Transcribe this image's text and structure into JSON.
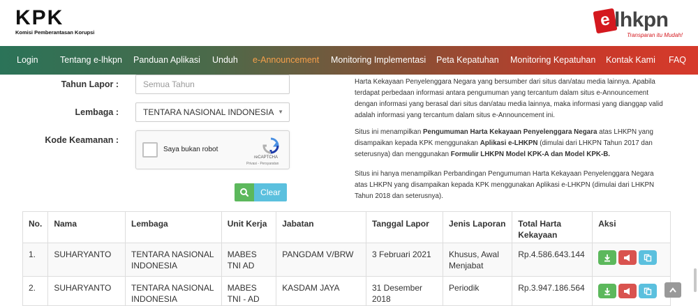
{
  "header": {
    "kpk_logo_text": "KPK",
    "kpk_subtitle": "Komisi Pemberantasan Korupsi",
    "elhkpn_e": "e",
    "elhkpn_word": "lhkpn",
    "elhkpn_tagline": "Transparan itu Mudah!"
  },
  "nav": {
    "items": [
      {
        "label": "Login"
      },
      {
        "label": "Tentang e-lhkpn"
      },
      {
        "label": "Panduan Aplikasi"
      },
      {
        "label": "Unduh"
      },
      {
        "label": "e-Announcement",
        "active": true
      },
      {
        "label": "Monitoring Implementasi"
      },
      {
        "label": "Peta Kepatuhan"
      },
      {
        "label": "Monitoring Kepatuhan"
      },
      {
        "label": "Kontak Kami"
      },
      {
        "label": "FAQ"
      }
    ],
    "active_color": "#f6a04b"
  },
  "form": {
    "tahun_label": "Tahun Lapor :",
    "tahun_placeholder": "Semua Tahun",
    "lembaga_label": "Lembaga :",
    "lembaga_value": "TENTARA NASIONAL INDONESIA",
    "kode_label": "Kode Keamanan :",
    "captcha_label": "Saya bukan robot",
    "captcha_brand": "reCAPTCHA",
    "captcha_links": "Privasi - Persyaratan",
    "clear_label": "Clear"
  },
  "info": {
    "p1": "Harta Kekayaan Penyelenggara Negara yang bersumber dari situs dan/atau media lainnya. Apabila terdapat perbedaan informasi antara pengumuman yang tercantum dalam situs e-Announcement dengan informasi yang berasal dari situs dan/atau media lainnya, maka informasi yang dianggap valid adalah informasi yang tercantum dalam situs e-Announcement ini.",
    "p2_a": "Situs ini menampilkan ",
    "p2_b": "Pengumuman Harta Kekayaan Penyelenggara Negara",
    "p2_c": " atas LHKPN yang disampaikan kepada KPK menggunakan ",
    "p2_d": "Aplikasi e-LHKPN",
    "p2_e": " (dimulai dari LHKPN Tahun 2017 dan seterusnya) dan menggunakan ",
    "p2_f": "Formulir LHKPN Model KPK-A dan Model KPK-B.",
    "p3": "Situs ini hanya menampilkan Perbandingan Pengumuman Harta Kekayaan Penyelenggara Negara atas LHKPN yang disampaikan kepada KPK menggunakan Aplikasi e-LHKPN (dimulai dari LHKPN Tahun 2018 dan seterusnya)."
  },
  "table": {
    "headers": {
      "no": "No.",
      "nama": "Nama",
      "lembaga": "Lembaga",
      "unit": "Unit Kerja",
      "jabatan": "Jabatan",
      "tanggal": "Tanggal Lapor",
      "jenis": "Jenis Laporan",
      "total": "Total Harta Kekayaan",
      "aksi": "Aksi"
    },
    "rows": [
      {
        "no": "1.",
        "nama": "SUHARYANTO",
        "lembaga": "TENTARA NASIONAL INDONESIA",
        "unit": "MABES TNI AD",
        "jabatan": "PANGDAM V/BRW",
        "tanggal": "3 Februari 2021",
        "jenis": "Khusus, Awal Menjabat",
        "total": "Rp.4.586.643.144"
      },
      {
        "no": "2.",
        "nama": "SUHARYANTO",
        "lembaga": "TENTARA NASIONAL INDONESIA",
        "unit": "MABES TNI - AD",
        "jabatan": "KASDAM JAYA",
        "tanggal": "31 Desember 2018",
        "jenis": "Periodik",
        "total": "Rp.3.947.186.564"
      }
    ]
  },
  "colors": {
    "btn_green": "#5cb85c",
    "btn_red": "#d9534f",
    "btn_blue": "#5bc0de",
    "brand_red": "#d4191f"
  }
}
